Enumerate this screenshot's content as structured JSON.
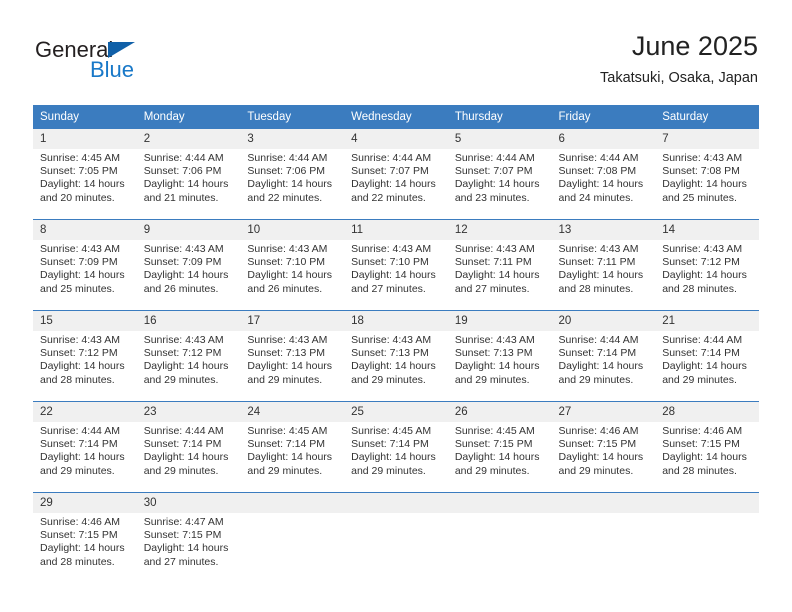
{
  "brand": {
    "name_part1": "General",
    "name_part2": "Blue"
  },
  "header": {
    "title": "June 2025",
    "subtitle": "Takatsuki, Osaka, Japan"
  },
  "colors": {
    "header_blue": "#3b7cbf",
    "daynum_band": "#f0f0f0",
    "brand_blue": "#1878c8",
    "logo_triangle": "#1060a8"
  },
  "weekday_headers": [
    "Sunday",
    "Monday",
    "Tuesday",
    "Wednesday",
    "Thursday",
    "Friday",
    "Saturday"
  ],
  "weeks": [
    [
      {
        "day": "1",
        "sunrise": "Sunrise: 4:45 AM",
        "sunset": "Sunset: 7:05 PM",
        "daylight1": "Daylight: 14 hours",
        "daylight2": "and 20 minutes."
      },
      {
        "day": "2",
        "sunrise": "Sunrise: 4:44 AM",
        "sunset": "Sunset: 7:06 PM",
        "daylight1": "Daylight: 14 hours",
        "daylight2": "and 21 minutes."
      },
      {
        "day": "3",
        "sunrise": "Sunrise: 4:44 AM",
        "sunset": "Sunset: 7:06 PM",
        "daylight1": "Daylight: 14 hours",
        "daylight2": "and 22 minutes."
      },
      {
        "day": "4",
        "sunrise": "Sunrise: 4:44 AM",
        "sunset": "Sunset: 7:07 PM",
        "daylight1": "Daylight: 14 hours",
        "daylight2": "and 22 minutes."
      },
      {
        "day": "5",
        "sunrise": "Sunrise: 4:44 AM",
        "sunset": "Sunset: 7:07 PM",
        "daylight1": "Daylight: 14 hours",
        "daylight2": "and 23 minutes."
      },
      {
        "day": "6",
        "sunrise": "Sunrise: 4:44 AM",
        "sunset": "Sunset: 7:08 PM",
        "daylight1": "Daylight: 14 hours",
        "daylight2": "and 24 minutes."
      },
      {
        "day": "7",
        "sunrise": "Sunrise: 4:43 AM",
        "sunset": "Sunset: 7:08 PM",
        "daylight1": "Daylight: 14 hours",
        "daylight2": "and 25 minutes."
      }
    ],
    [
      {
        "day": "8",
        "sunrise": "Sunrise: 4:43 AM",
        "sunset": "Sunset: 7:09 PM",
        "daylight1": "Daylight: 14 hours",
        "daylight2": "and 25 minutes."
      },
      {
        "day": "9",
        "sunrise": "Sunrise: 4:43 AM",
        "sunset": "Sunset: 7:09 PM",
        "daylight1": "Daylight: 14 hours",
        "daylight2": "and 26 minutes."
      },
      {
        "day": "10",
        "sunrise": "Sunrise: 4:43 AM",
        "sunset": "Sunset: 7:10 PM",
        "daylight1": "Daylight: 14 hours",
        "daylight2": "and 26 minutes."
      },
      {
        "day": "11",
        "sunrise": "Sunrise: 4:43 AM",
        "sunset": "Sunset: 7:10 PM",
        "daylight1": "Daylight: 14 hours",
        "daylight2": "and 27 minutes."
      },
      {
        "day": "12",
        "sunrise": "Sunrise: 4:43 AM",
        "sunset": "Sunset: 7:11 PM",
        "daylight1": "Daylight: 14 hours",
        "daylight2": "and 27 minutes."
      },
      {
        "day": "13",
        "sunrise": "Sunrise: 4:43 AM",
        "sunset": "Sunset: 7:11 PM",
        "daylight1": "Daylight: 14 hours",
        "daylight2": "and 28 minutes."
      },
      {
        "day": "14",
        "sunrise": "Sunrise: 4:43 AM",
        "sunset": "Sunset: 7:12 PM",
        "daylight1": "Daylight: 14 hours",
        "daylight2": "and 28 minutes."
      }
    ],
    [
      {
        "day": "15",
        "sunrise": "Sunrise: 4:43 AM",
        "sunset": "Sunset: 7:12 PM",
        "daylight1": "Daylight: 14 hours",
        "daylight2": "and 28 minutes."
      },
      {
        "day": "16",
        "sunrise": "Sunrise: 4:43 AM",
        "sunset": "Sunset: 7:12 PM",
        "daylight1": "Daylight: 14 hours",
        "daylight2": "and 29 minutes."
      },
      {
        "day": "17",
        "sunrise": "Sunrise: 4:43 AM",
        "sunset": "Sunset: 7:13 PM",
        "daylight1": "Daylight: 14 hours",
        "daylight2": "and 29 minutes."
      },
      {
        "day": "18",
        "sunrise": "Sunrise: 4:43 AM",
        "sunset": "Sunset: 7:13 PM",
        "daylight1": "Daylight: 14 hours",
        "daylight2": "and 29 minutes."
      },
      {
        "day": "19",
        "sunrise": "Sunrise: 4:43 AM",
        "sunset": "Sunset: 7:13 PM",
        "daylight1": "Daylight: 14 hours",
        "daylight2": "and 29 minutes."
      },
      {
        "day": "20",
        "sunrise": "Sunrise: 4:44 AM",
        "sunset": "Sunset: 7:14 PM",
        "daylight1": "Daylight: 14 hours",
        "daylight2": "and 29 minutes."
      },
      {
        "day": "21",
        "sunrise": "Sunrise: 4:44 AM",
        "sunset": "Sunset: 7:14 PM",
        "daylight1": "Daylight: 14 hours",
        "daylight2": "and 29 minutes."
      }
    ],
    [
      {
        "day": "22",
        "sunrise": "Sunrise: 4:44 AM",
        "sunset": "Sunset: 7:14 PM",
        "daylight1": "Daylight: 14 hours",
        "daylight2": "and 29 minutes."
      },
      {
        "day": "23",
        "sunrise": "Sunrise: 4:44 AM",
        "sunset": "Sunset: 7:14 PM",
        "daylight1": "Daylight: 14 hours",
        "daylight2": "and 29 minutes."
      },
      {
        "day": "24",
        "sunrise": "Sunrise: 4:45 AM",
        "sunset": "Sunset: 7:14 PM",
        "daylight1": "Daylight: 14 hours",
        "daylight2": "and 29 minutes."
      },
      {
        "day": "25",
        "sunrise": "Sunrise: 4:45 AM",
        "sunset": "Sunset: 7:14 PM",
        "daylight1": "Daylight: 14 hours",
        "daylight2": "and 29 minutes."
      },
      {
        "day": "26",
        "sunrise": "Sunrise: 4:45 AM",
        "sunset": "Sunset: 7:15 PM",
        "daylight1": "Daylight: 14 hours",
        "daylight2": "and 29 minutes."
      },
      {
        "day": "27",
        "sunrise": "Sunrise: 4:46 AM",
        "sunset": "Sunset: 7:15 PM",
        "daylight1": "Daylight: 14 hours",
        "daylight2": "and 29 minutes."
      },
      {
        "day": "28",
        "sunrise": "Sunrise: 4:46 AM",
        "sunset": "Sunset: 7:15 PM",
        "daylight1": "Daylight: 14 hours",
        "daylight2": "and 28 minutes."
      }
    ],
    [
      {
        "day": "29",
        "sunrise": "Sunrise: 4:46 AM",
        "sunset": "Sunset: 7:15 PM",
        "daylight1": "Daylight: 14 hours",
        "daylight2": "and 28 minutes."
      },
      {
        "day": "30",
        "sunrise": "Sunrise: 4:47 AM",
        "sunset": "Sunset: 7:15 PM",
        "daylight1": "Daylight: 14 hours",
        "daylight2": "and 27 minutes."
      },
      {
        "day": "",
        "sunrise": "",
        "sunset": "",
        "daylight1": "",
        "daylight2": ""
      },
      {
        "day": "",
        "sunrise": "",
        "sunset": "",
        "daylight1": "",
        "daylight2": ""
      },
      {
        "day": "",
        "sunrise": "",
        "sunset": "",
        "daylight1": "",
        "daylight2": ""
      },
      {
        "day": "",
        "sunrise": "",
        "sunset": "",
        "daylight1": "",
        "daylight2": ""
      },
      {
        "day": "",
        "sunrise": "",
        "sunset": "",
        "daylight1": "",
        "daylight2": ""
      }
    ]
  ]
}
